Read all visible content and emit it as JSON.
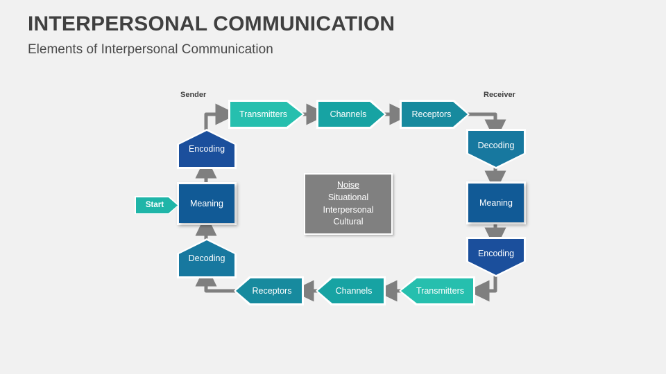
{
  "header": {
    "title": "INTERPERSONAL COMMUNICATION",
    "subtitle": "Elements of Interpersonal Communication"
  },
  "labels": {
    "sender": "Sender",
    "receiver": "Receiver"
  },
  "nodes": {
    "start": "Start",
    "sender_encoding": "Encoding",
    "sender_transmitters": "Transmitters",
    "top_channels": "Channels",
    "receiver_receptors": "Receptors",
    "receiver_decoding": "Decoding",
    "receiver_meaning": "Meaning",
    "receiver_encoding": "Encoding",
    "receiver_transmitters": "Transmitters",
    "bottom_channels": "Channels",
    "sender_receptors": "Receptors",
    "sender_decoding": "Decoding",
    "sender_meaning": "Meaning"
  },
  "noise": {
    "heading": "Noise",
    "items": [
      "Situational",
      "Interpersonal",
      "Cultural"
    ],
    "line1": "Situational",
    "line2": "Interpersonal",
    "line3": "Cultural"
  },
  "colors": {
    "background": "#f1f1f1",
    "title_text": "#404040",
    "navy": "#1b4f9c",
    "deep_blue": "#115a96",
    "steel_blue": "#17789f",
    "teal_dark": "#178a9e",
    "teal_mid": "#17a3a3",
    "teal_bright": "#26bfae",
    "noise_gray": "#808080",
    "arrow_gray": "#7f7f7f",
    "white": "#ffffff"
  },
  "flow": {
    "type": "cycle",
    "steps": [
      "Start",
      "Meaning (Sender)",
      "Encoding (Sender)",
      "Transmitters",
      "Channels",
      "Receptors",
      "Decoding (Receiver)",
      "Meaning (Receiver)",
      "Encoding (Receiver)",
      "Transmitters",
      "Channels",
      "Receptors",
      "Decoding (Sender)",
      "Meaning (Sender)"
    ]
  }
}
